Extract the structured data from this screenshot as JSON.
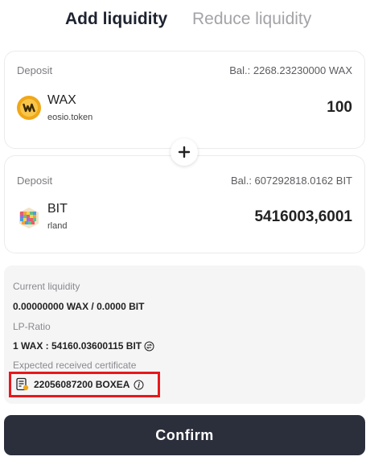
{
  "tabs": {
    "add": "Add liquidity",
    "reduce": "Reduce liquidity"
  },
  "deposit1": {
    "label": "Deposit",
    "balance": "Bal.:  2268.23230000 WAX",
    "token": "WAX",
    "contract": "eosio.token",
    "amount": "100",
    "icon": "wax-token-icon"
  },
  "deposit2": {
    "label": "Deposit",
    "balance": "Bal.:  607292818.0162 BIT",
    "token": "BIT",
    "contract": "rland",
    "amount": "5416003,6001",
    "icon": "bit-token-icon"
  },
  "plus_icon": "plus-icon",
  "info": {
    "current_liquidity_label": "Current liquidity",
    "current_liquidity_value": "0.00000000 WAX / 0.0000 BIT",
    "lp_ratio_label": "LP-Ratio",
    "lp_ratio_value": "1 WAX : 54160.03600115 BIT",
    "certificate_label": "Expected received certificate",
    "certificate_value": "22056087200 BOXEA"
  },
  "confirm_label": "Confirm",
  "colors": {
    "accent": "#2b2e3b",
    "highlight": "#e8181c",
    "wax": "#f0a818"
  }
}
